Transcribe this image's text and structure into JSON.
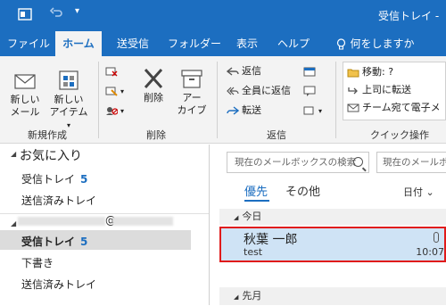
{
  "window": {
    "title": "受信トレイ -",
    "accent": "#1c6ec0"
  },
  "tabs": [
    {
      "label": "ファイル"
    },
    {
      "label": "ホーム"
    },
    {
      "label": "送受信"
    },
    {
      "label": "フォルダー"
    },
    {
      "label": "表示"
    },
    {
      "label": "ヘルプ"
    },
    {
      "label": "何をしますか"
    }
  ],
  "ribbon": {
    "new": {
      "new_mail_line1": "新しい",
      "new_mail_line2": "メール",
      "new_item_line1": "新しい",
      "new_item_line2": "アイテム",
      "group_label": "新規作成"
    },
    "delete": {
      "delete_label": "削除",
      "archive_line1": "アー",
      "archive_line2": "カイブ",
      "group_label": "削除"
    },
    "respond": {
      "reply": "返信",
      "reply_all": "全員に返信",
      "forward": "転送",
      "group_label": "返信"
    },
    "quick_steps": {
      "move": "移動: ?",
      "to_manager": "上司に転送",
      "team_email": "チーム宛て電子メ",
      "group_label": "クイック操作"
    }
  },
  "nav": {
    "favorites_label": "お気に入り",
    "favorites": [
      {
        "label": "受信トレイ",
        "count": "5"
      },
      {
        "label": "送信済みトレイ",
        "count": ""
      }
    ],
    "account_suffix": "@",
    "folders": [
      {
        "label": "受信トレイ",
        "count": "5",
        "selected": true
      },
      {
        "label": "下書き",
        "count": "",
        "selected": false
      },
      {
        "label": "送信済みトレイ",
        "count": "",
        "selected": false
      }
    ]
  },
  "messages": {
    "search_placeholder": "現在のメールボックスの検索",
    "search_scope": "現在のメールボッ",
    "filter_focused": "優先",
    "filter_other": "その他",
    "sort_label": "日付",
    "group_today": "今日",
    "group_last_month": "先月",
    "items": [
      {
        "from": "秋葉 一郎",
        "subject": "test",
        "time": "10:07",
        "has_attachment": true,
        "selected": true
      }
    ]
  }
}
